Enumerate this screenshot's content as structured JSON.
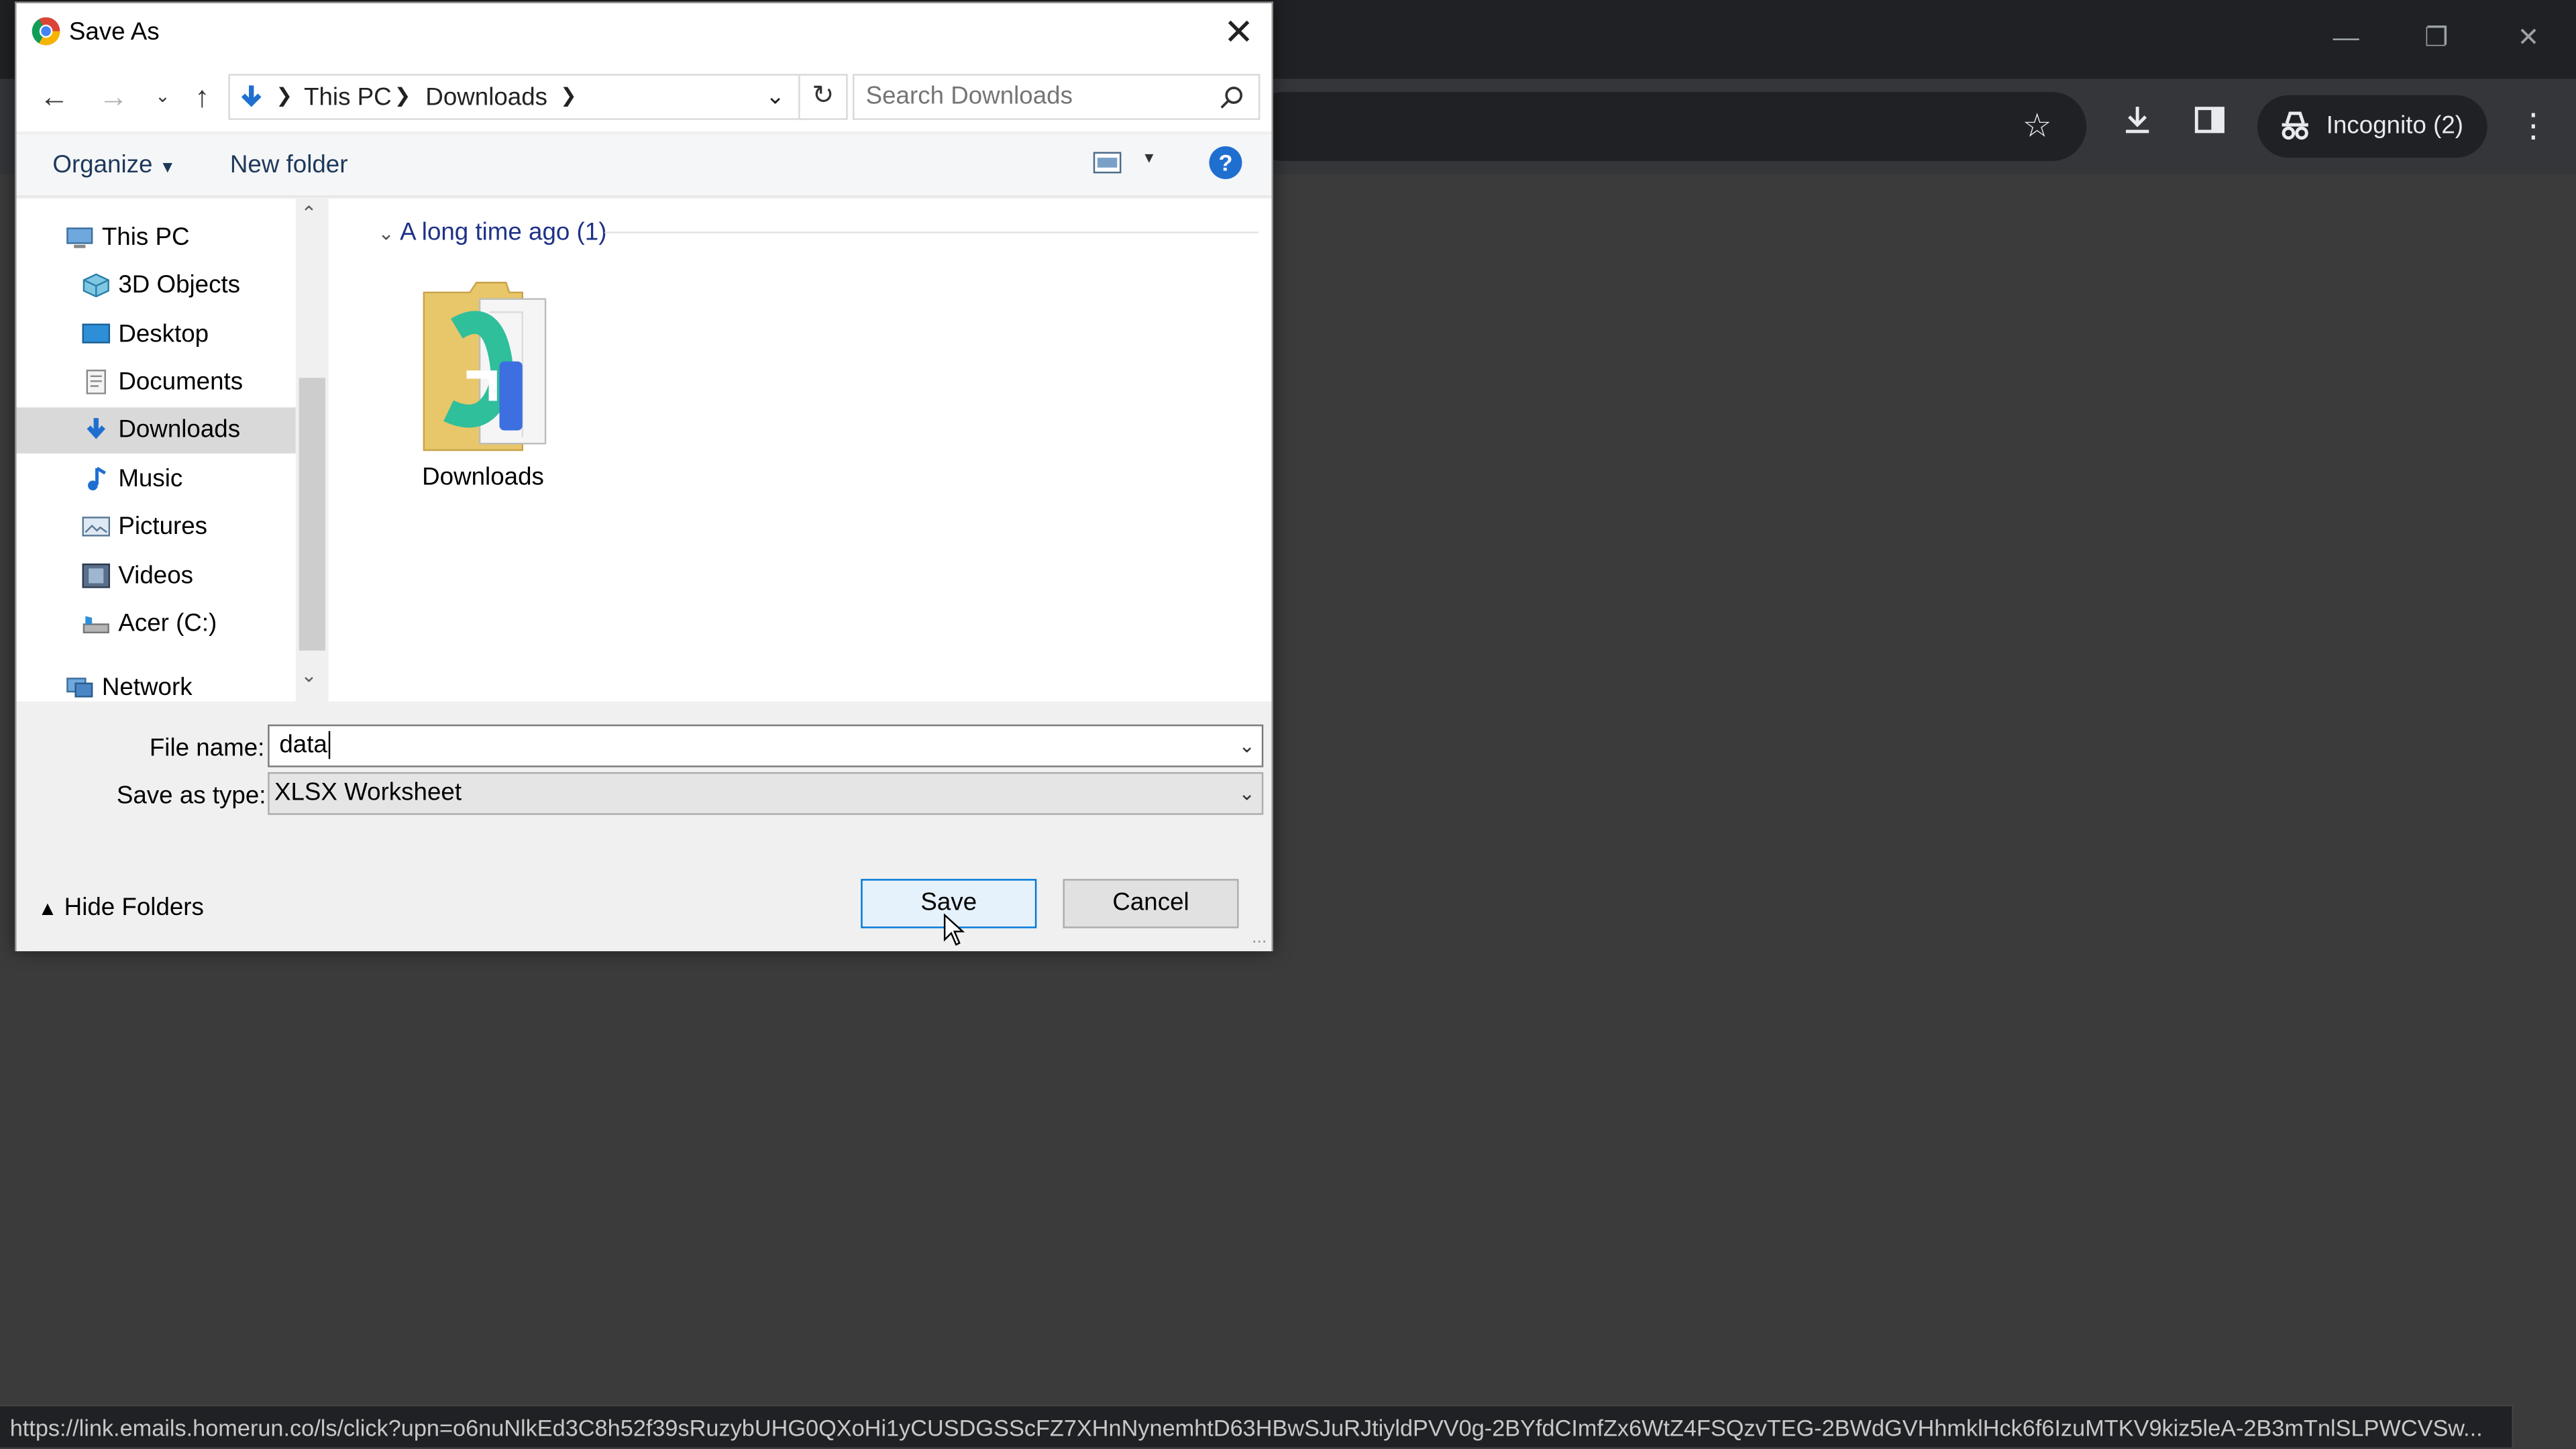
{
  "browser": {
    "incognito_label": "Incognito (2)",
    "status_url": "https://link.emails.homerun.co/ls/click?upn=o6nuNlkEd3C8h52f39sRuzybUHG0QXoHi1yCUSDGSScFZ7XHnNynemhtD63HBwSJuRJtiyldPVV0g-2BYfdCImfZx6WtZ4FSQzvTEG-2BWdGVHhmklHck6f6IzuMTKV9kiz5leA-2B3mTnlSLPWCVSw..."
  },
  "dialog": {
    "title": "Save As",
    "breadcrumb": [
      "This PC",
      "Downloads"
    ],
    "search_placeholder": "Search Downloads",
    "organize_label": "Organize",
    "new_folder_label": "New folder",
    "nav_items": [
      {
        "label": "This PC",
        "icon": "pc-icon"
      },
      {
        "label": "3D Objects",
        "icon": "cube-icon"
      },
      {
        "label": "Desktop",
        "icon": "desktop-icon"
      },
      {
        "label": "Documents",
        "icon": "documents-icon"
      },
      {
        "label": "Downloads",
        "icon": "download-icon",
        "selected": true
      },
      {
        "label": "Music",
        "icon": "music-icon"
      },
      {
        "label": "Pictures",
        "icon": "pictures-icon"
      },
      {
        "label": "Videos",
        "icon": "videos-icon"
      },
      {
        "label": "Acer (C:)",
        "icon": "drive-icon"
      },
      {
        "label": "Network",
        "icon": "network-icon"
      }
    ],
    "group_header": "A long time ago (1)",
    "items": [
      {
        "label": "Downloads",
        "icon": "folder-icon"
      }
    ],
    "file_name_label": "File name:",
    "file_name_value": "data",
    "save_type_label": "Save as type:",
    "save_type_value": "XLSX Worksheet",
    "save_label": "Save",
    "cancel_label": "Cancel",
    "hide_folders_label": "Hide Folders"
  },
  "colors": {
    "accent": "#0078d7",
    "chrome_dark": "#202124",
    "page_bg": "#3b3b3b"
  }
}
